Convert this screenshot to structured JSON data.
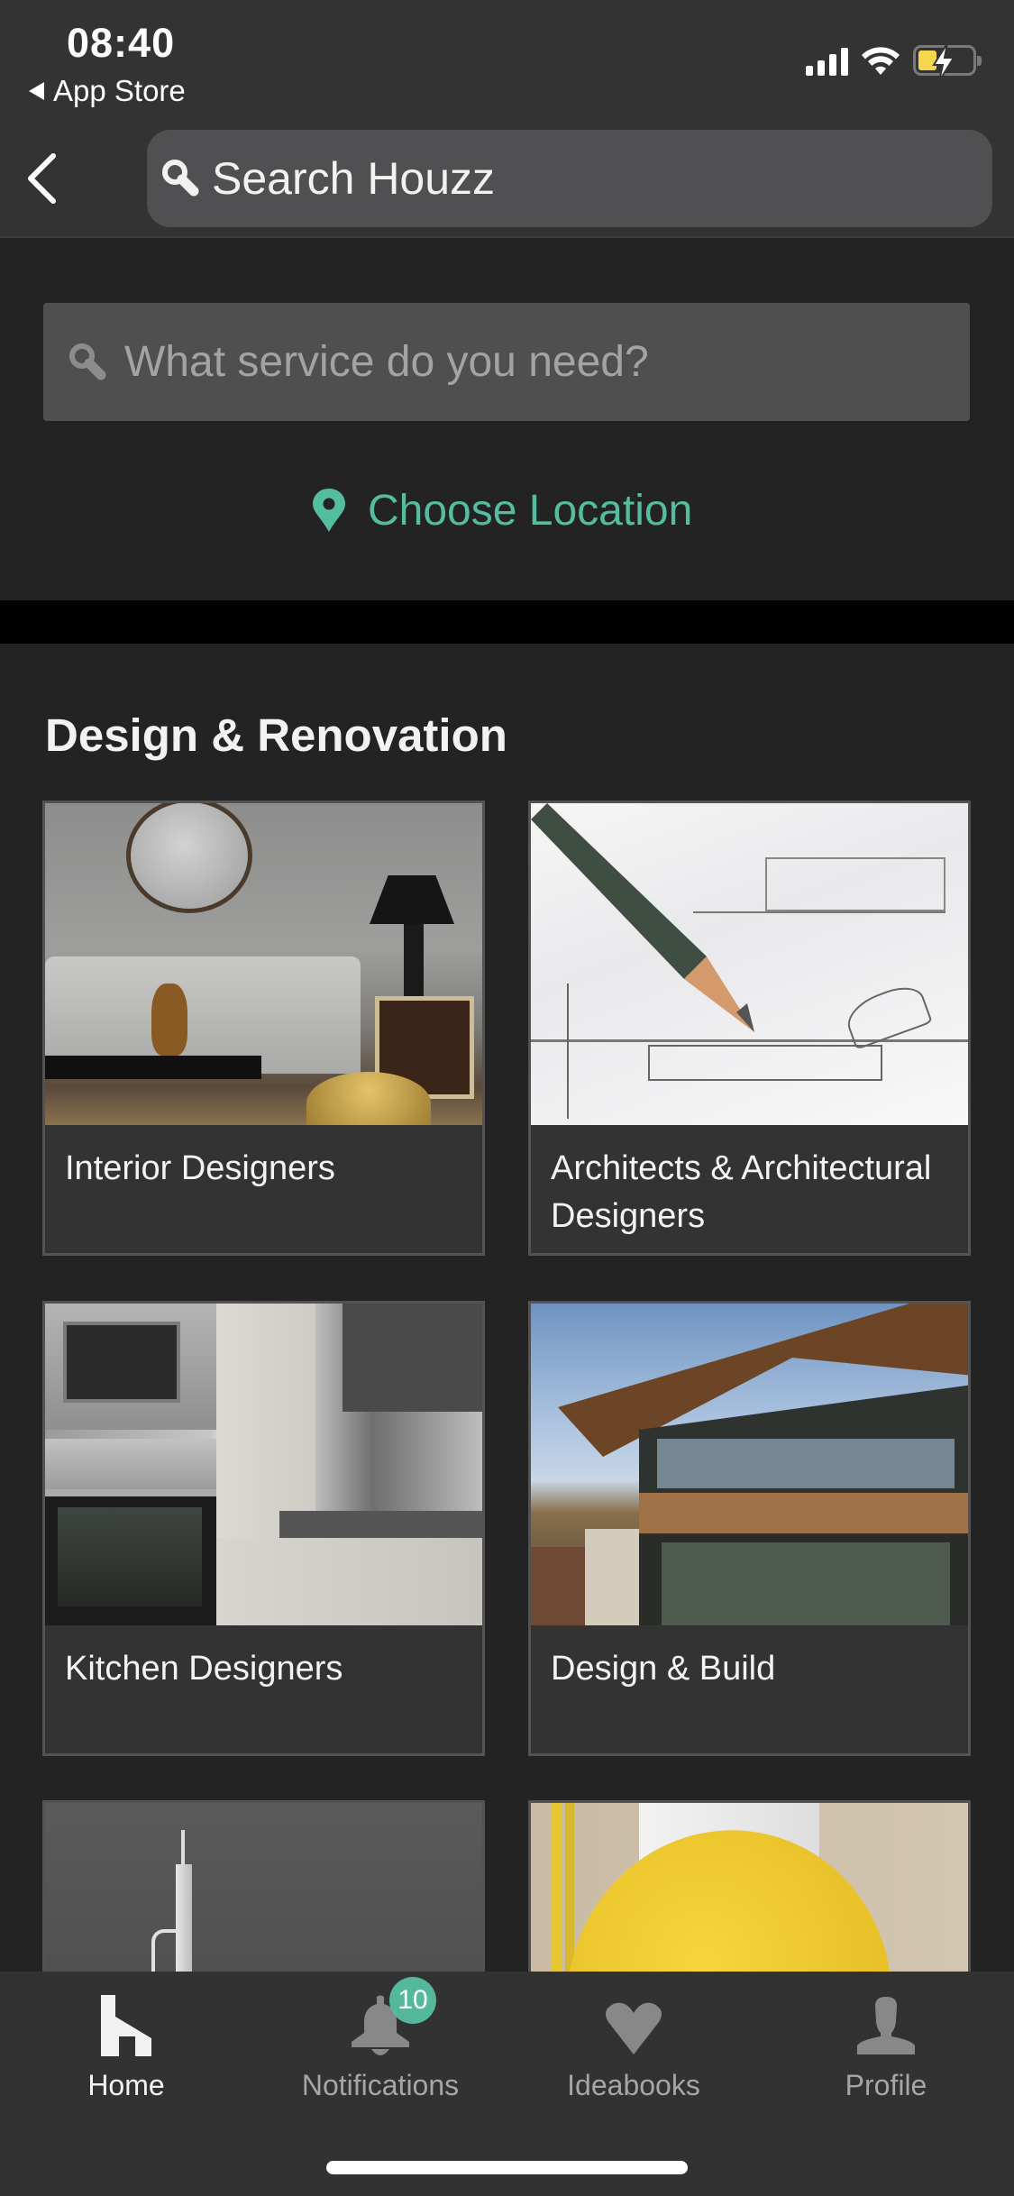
{
  "status_bar": {
    "time": "08:40",
    "back_app": "App Store",
    "signal_bars": 4,
    "wifi": "full",
    "battery_level": 0.35,
    "battery_charging": true,
    "battery_color": "#f5d64c"
  },
  "header": {
    "back_icon": "chevron-left-icon",
    "search_icon": "search-icon",
    "search_placeholder": "Search Houzz"
  },
  "service_search": {
    "icon": "search-icon",
    "placeholder": "What service do you need?"
  },
  "location": {
    "icon": "map-pin-icon",
    "label": "Choose Location",
    "color": "#54bd9f"
  },
  "section": {
    "title": "Design & Renovation",
    "cards": [
      {
        "label": "Interior Designers",
        "image": "living room with sofa, round mirror and table lamp"
      },
      {
        "label": "Architects & Architectural Designers",
        "image": "pencil on architectural blueprint"
      },
      {
        "label": "Kitchen Designers",
        "image": "modern kitchen with built-in oven and microwave"
      },
      {
        "label": "Design & Build",
        "image": "modern house with wooden roof and glass facade"
      },
      {
        "label": "",
        "image": "freestanding bathtub with floor faucet"
      },
      {
        "label": "",
        "image": "yellow hard hat with blueprints and folding ruler"
      }
    ]
  },
  "tab_bar": {
    "tabs": [
      {
        "label": "Home",
        "icon": "houzz-home-icon",
        "active": true
      },
      {
        "label": "Notifications",
        "icon": "bell-icon",
        "active": false,
        "badge": "10"
      },
      {
        "label": "Ideabooks",
        "icon": "heart-icon",
        "active": false
      },
      {
        "label": "Profile",
        "icon": "person-icon",
        "active": false
      }
    ],
    "badge_color": "#55b89d"
  }
}
